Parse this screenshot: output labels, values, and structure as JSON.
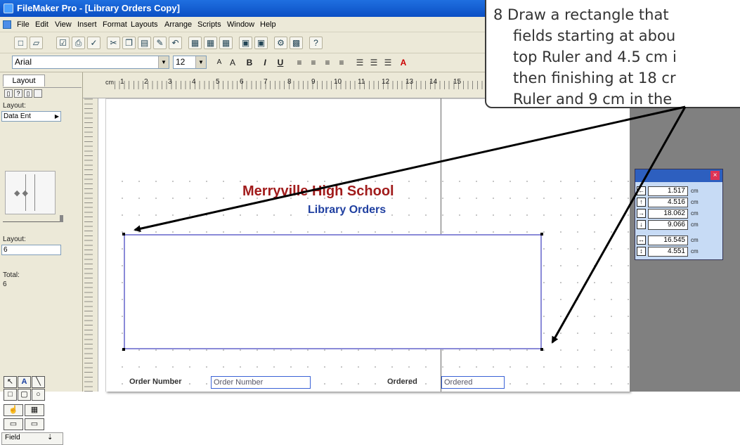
{
  "window": {
    "title": "FileMaker Pro - [Library Orders Copy]"
  },
  "menu": [
    "File",
    "Edit",
    "View",
    "Insert",
    "Format",
    "Layouts",
    "Arrange",
    "Scripts",
    "Window",
    "Help"
  ],
  "format_bar": {
    "font": "Arial",
    "size": "12",
    "buttons": [
      "A",
      "A",
      "B",
      "I",
      "U"
    ]
  },
  "ruler": {
    "unit": "cm",
    "ticks": [
      "1",
      "2",
      "3",
      "4",
      "5",
      "6",
      "7",
      "8",
      "9",
      "10",
      "11",
      "12",
      "13",
      "14",
      "15"
    ]
  },
  "status_area": {
    "mode": "Layout",
    "layout_label": "Layout:",
    "layout_value": "Data Ent",
    "layout_number_label": "Layout:",
    "layout_number": "6",
    "total_label": "Total:",
    "total_value": "6",
    "field_label": "Field"
  },
  "layout": {
    "school_title": "Merryville High School",
    "subtitle": "Library Orders",
    "fields": [
      {
        "label": "Order Number",
        "value": "Order Number"
      },
      {
        "label": "Ordered",
        "value": "Ordered"
      }
    ],
    "title_color": "#a11c1c",
    "subtitle_color": "#1f3fa0",
    "selection_color": "#8a8ad8"
  },
  "size_palette": {
    "rows": [
      {
        "icon": "left-edge-icon",
        "value": "1.517",
        "unit": "cm"
      },
      {
        "icon": "top-edge-icon",
        "value": "4.516",
        "unit": "cm"
      },
      {
        "icon": "right-edge-icon",
        "value": "18.062",
        "unit": "cm"
      },
      {
        "icon": "bottom-edge-icon",
        "value": "9.066",
        "unit": "cm"
      },
      {
        "icon": "width-icon",
        "value": "16.545",
        "unit": "cm"
      },
      {
        "icon": "height-icon",
        "value": "4.551",
        "unit": "cm"
      }
    ]
  },
  "callout": {
    "lines": [
      "8  Draw a rectangle that",
      "fields starting at abou",
      "top Ruler and 4.5 cm i",
      "then finishing at 18 cr",
      "Ruler and 9 cm in the"
    ]
  }
}
